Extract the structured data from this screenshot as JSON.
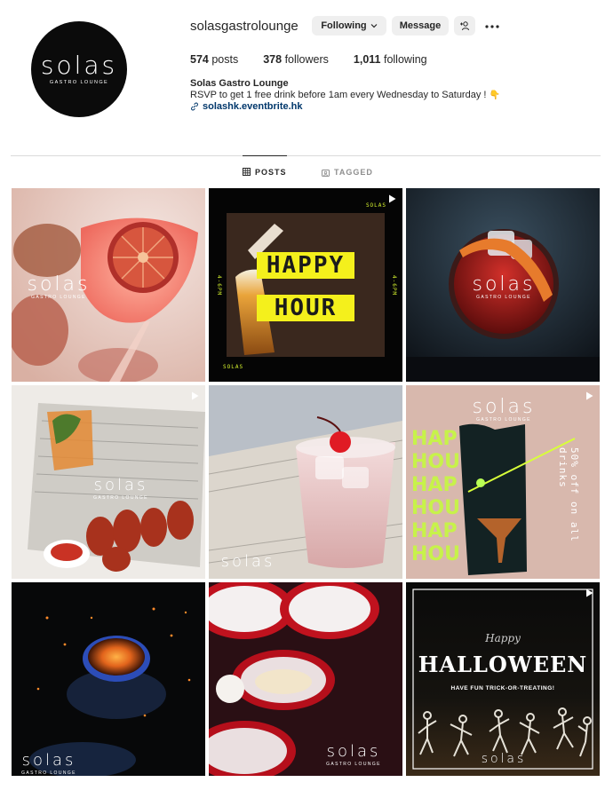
{
  "profile": {
    "avatar_logo": "solas",
    "avatar_sub": "GASTRO LOUNGE",
    "username": "solasgastrolounge",
    "following_label": "Following",
    "message_label": "Message",
    "posts_count": "574",
    "posts_label": "posts",
    "followers_count": "378",
    "followers_label": "followers",
    "following_count": "1,011",
    "following_count_label": "following",
    "full_name": "Solas Gastro Lounge",
    "bio": "RSVP to get 1 free drink before 1am every Wednesday to Saturday !",
    "bio_emoji": "👇",
    "link": "solashk.eventbrite.hk"
  },
  "tabs": {
    "posts": "POSTS",
    "tagged": "TAGGED"
  },
  "icons": [
    "chevron-down-icon",
    "add-person-icon",
    "more-icon",
    "link-icon",
    "grid-icon",
    "tagged-icon",
    "reel-icon"
  ],
  "colors": {
    "link": "#00376b",
    "button_bg": "#efefef",
    "happy_hour_yellow": "#f4f01c",
    "neon_green": "#c7f24a"
  },
  "posts": [
    {
      "watermark": "solas",
      "watermark_sub": "GASTRO LOUNGE"
    },
    {
      "brand": "SOLAS",
      "brand_bottom": "SOLAS",
      "time_left": "4-6PM",
      "time_right": "4-6PM",
      "line1": "HAPPY",
      "line2": "HOUR"
    },
    {
      "watermark": "solas",
      "watermark_sub": "GASTRO LOUNGE"
    },
    {
      "watermark": "solas",
      "watermark_sub": "GASTRO LOUNGE"
    },
    {
      "watermark": "solas"
    },
    {
      "watermark": "solas",
      "watermark_sub": "GASTRO LOUNGE",
      "side_text": "50% off on all drinks",
      "stack": [
        "HAP",
        "HOU",
        "HAP",
        "HOU",
        "HAP",
        "HOU"
      ]
    },
    {
      "watermark": "solas",
      "watermark_sub": "GASTRO LOUNGE"
    },
    {
      "watermark": "solas",
      "watermark_sub": "GASTRO LOUNGE"
    },
    {
      "happy": "Happy",
      "title": "HALLOWEEN",
      "subtitle": "HAVE FUN TRICK-OR-TREATING!",
      "watermark": "solas"
    }
  ]
}
